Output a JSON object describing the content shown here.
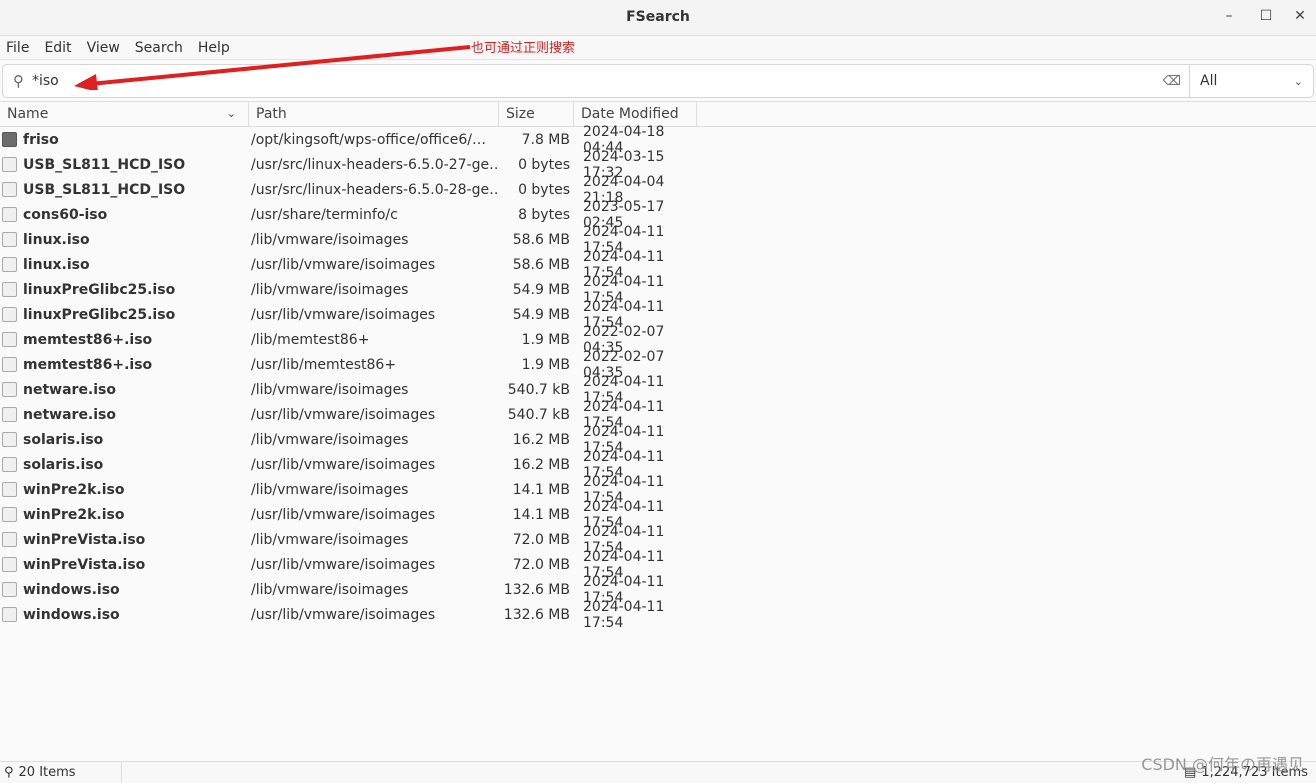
{
  "window": {
    "title": "FSearch",
    "minimize": "–",
    "maximize": "☐",
    "close": "✕"
  },
  "menu": [
    "File",
    "Edit",
    "View",
    "Search",
    "Help"
  ],
  "annotation": "也可通过正则搜索",
  "search": {
    "value": "*iso",
    "filter": "All"
  },
  "columns": [
    "Name",
    "Path",
    "Size",
    "Date Modified"
  ],
  "rows": [
    {
      "name": "friso",
      "type": "folder",
      "path": "/opt/kingsoft/wps-office/office6/…",
      "size": "7.8 MB",
      "date": "2024-04-18 04:44"
    },
    {
      "name": "USB_SL811_HCD_ISO",
      "type": "binary",
      "path": "/usr/src/linux-headers-6.5.0-27-ge…",
      "size": "0 bytes",
      "date": "2024-03-15 17:32"
    },
    {
      "name": "USB_SL811_HCD_ISO",
      "type": "binary",
      "path": "/usr/src/linux-headers-6.5.0-28-ge…",
      "size": "0 bytes",
      "date": "2024-04-04 21:18"
    },
    {
      "name": "cons60-iso",
      "type": "binary",
      "path": "/usr/share/terminfo/c",
      "size": "8 bytes",
      "date": "2023-05-17 02:45"
    },
    {
      "name": "linux.iso",
      "type": "file",
      "path": "/lib/vmware/isoimages",
      "size": "58.6 MB",
      "date": "2024-04-11 17:54"
    },
    {
      "name": "linux.iso",
      "type": "file",
      "path": "/usr/lib/vmware/isoimages",
      "size": "58.6 MB",
      "date": "2024-04-11 17:54"
    },
    {
      "name": "linuxPreGlibc25.iso",
      "type": "file",
      "path": "/lib/vmware/isoimages",
      "size": "54.9 MB",
      "date": "2024-04-11 17:54"
    },
    {
      "name": "linuxPreGlibc25.iso",
      "type": "file",
      "path": "/usr/lib/vmware/isoimages",
      "size": "54.9 MB",
      "date": "2024-04-11 17:54"
    },
    {
      "name": "memtest86+.iso",
      "type": "file",
      "path": "/lib/memtest86+",
      "size": "1.9 MB",
      "date": "2022-02-07 04:35"
    },
    {
      "name": "memtest86+.iso",
      "type": "file",
      "path": "/usr/lib/memtest86+",
      "size": "1.9 MB",
      "date": "2022-02-07 04:35"
    },
    {
      "name": "netware.iso",
      "type": "file",
      "path": "/lib/vmware/isoimages",
      "size": "540.7 kB",
      "date": "2024-04-11 17:54"
    },
    {
      "name": "netware.iso",
      "type": "file",
      "path": "/usr/lib/vmware/isoimages",
      "size": "540.7 kB",
      "date": "2024-04-11 17:54"
    },
    {
      "name": "solaris.iso",
      "type": "file",
      "path": "/lib/vmware/isoimages",
      "size": "16.2 MB",
      "date": "2024-04-11 17:54"
    },
    {
      "name": "solaris.iso",
      "type": "file",
      "path": "/usr/lib/vmware/isoimages",
      "size": "16.2 MB",
      "date": "2024-04-11 17:54"
    },
    {
      "name": "winPre2k.iso",
      "type": "file",
      "path": "/lib/vmware/isoimages",
      "size": "14.1 MB",
      "date": "2024-04-11 17:54"
    },
    {
      "name": "winPre2k.iso",
      "type": "file",
      "path": "/usr/lib/vmware/isoimages",
      "size": "14.1 MB",
      "date": "2024-04-11 17:54"
    },
    {
      "name": "winPreVista.iso",
      "type": "file",
      "path": "/lib/vmware/isoimages",
      "size": "72.0 MB",
      "date": "2024-04-11 17:54"
    },
    {
      "name": "winPreVista.iso",
      "type": "file",
      "path": "/usr/lib/vmware/isoimages",
      "size": "72.0 MB",
      "date": "2024-04-11 17:54"
    },
    {
      "name": "windows.iso",
      "type": "file",
      "path": "/lib/vmware/isoimages",
      "size": "132.6 MB",
      "date": "2024-04-11 17:54"
    },
    {
      "name": "windows.iso",
      "type": "file",
      "path": "/usr/lib/vmware/isoimages",
      "size": "132.6 MB",
      "date": "2024-04-11 17:54"
    }
  ],
  "status": {
    "results": "20 Items",
    "total": "1,224,723 Items"
  },
  "watermark": "CSDN @何年の再遇见",
  "colors": {
    "annotation": "#e02020"
  }
}
